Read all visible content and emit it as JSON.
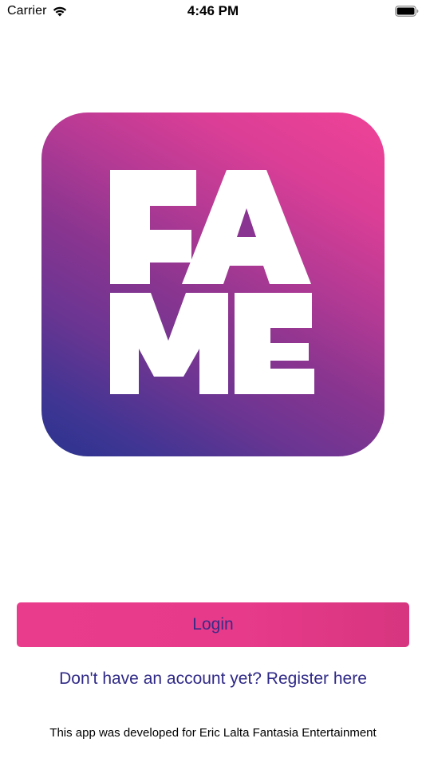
{
  "status_bar": {
    "carrier": "Carrier",
    "time": "4:46 PM",
    "icons": [
      "wifi-icon",
      "battery-icon"
    ]
  },
  "logo": {
    "text": "FAME",
    "colors": {
      "gradient_start": "#2a348e",
      "gradient_end": "#ef4397",
      "letters": "#ffffff"
    }
  },
  "login": {
    "label": "Login",
    "color": "#e83a8b"
  },
  "register": {
    "label": "Don't have an account yet? Register here"
  },
  "footer": {
    "text": "This app was developed for Eric Lalta Fantasia Entertainment"
  }
}
